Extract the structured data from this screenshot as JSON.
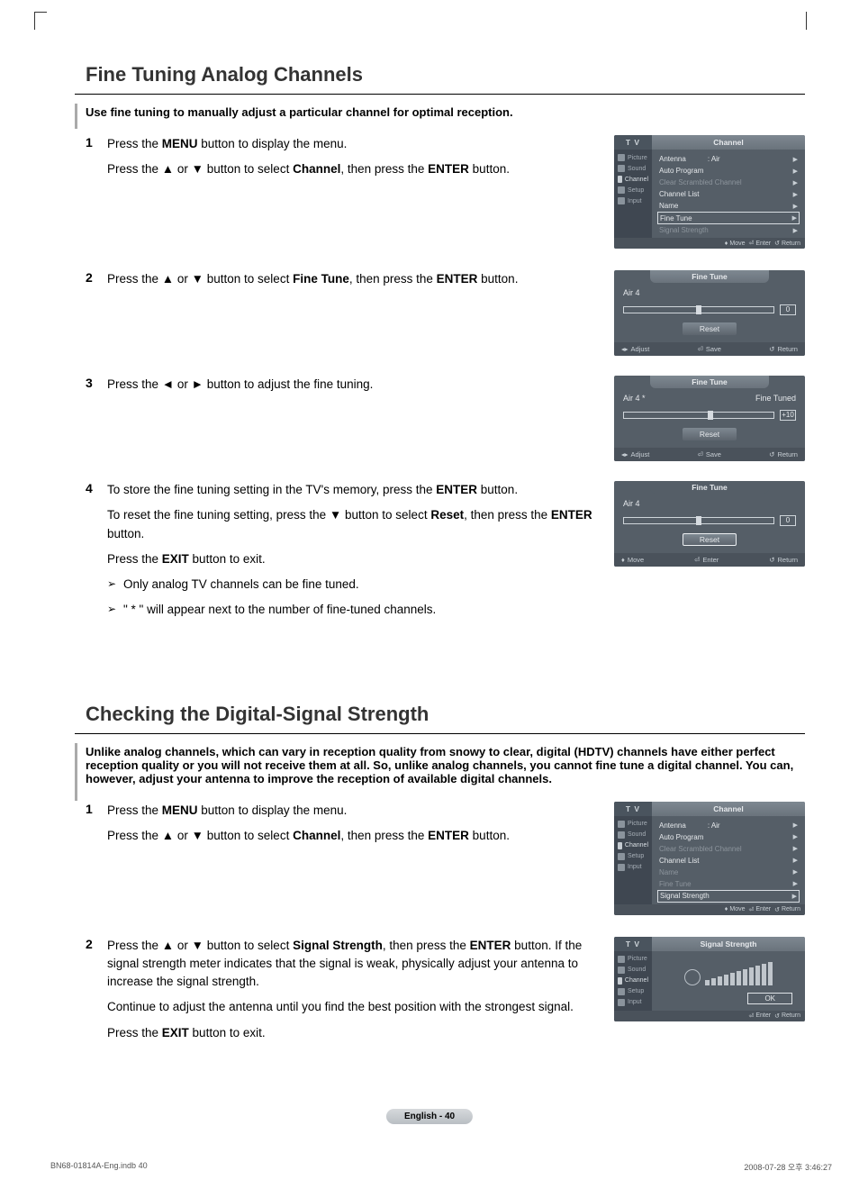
{
  "section1": {
    "title": "Fine Tuning Analog Channels",
    "intro": "Use fine tuning to manually adjust a particular channel for optimal reception.",
    "steps": [
      {
        "num": "1",
        "lines": [
          {
            "segments": [
              {
                "t": "Press the "
              },
              {
                "t": "MENU",
                "b": true
              },
              {
                "t": " button to display the menu."
              }
            ]
          },
          {
            "segments": [
              {
                "t": "Press the ▲ or ▼ button to select "
              },
              {
                "t": "Channel",
                "b": true
              },
              {
                "t": ", then press the "
              },
              {
                "t": "ENTER",
                "b": true
              },
              {
                "t": " button."
              }
            ]
          }
        ]
      },
      {
        "num": "2",
        "lines": [
          {
            "segments": [
              {
                "t": "Press the ▲ or ▼ button to select "
              },
              {
                "t": "Fine Tune",
                "b": true
              },
              {
                "t": ", then press the "
              },
              {
                "t": "ENTER",
                "b": true
              },
              {
                "t": " button."
              }
            ]
          }
        ]
      },
      {
        "num": "3",
        "lines": [
          {
            "segments": [
              {
                "t": "Press the ◄ or ► button to adjust the fine tuning."
              }
            ]
          }
        ]
      },
      {
        "num": "4",
        "lines": [
          {
            "segments": [
              {
                "t": "To store the fine tuning setting in the TV's memory, press the "
              },
              {
                "t": "ENTER",
                "b": true
              },
              {
                "t": " button."
              }
            ]
          },
          {
            "segments": [
              {
                "t": "To reset the fine tuning setting, press the ▼ button to select "
              },
              {
                "t": "Reset",
                "b": true
              },
              {
                "t": ", then press the "
              },
              {
                "t": "ENTER",
                "b": true
              },
              {
                "t": " button."
              }
            ]
          },
          {
            "segments": [
              {
                "t": "Press the "
              },
              {
                "t": "EXIT",
                "b": true
              },
              {
                "t": " button to exit."
              }
            ]
          }
        ],
        "notes": [
          "Only analog TV channels can be fine tuned.",
          "\" * \" will appear next to the number of fine-tuned channels."
        ]
      }
    ]
  },
  "section2": {
    "title": "Checking the Digital-Signal Strength",
    "intro": "Unlike analog channels, which can vary in reception quality from snowy to clear, digital (HDTV) channels have either perfect reception quality or you will not receive them at all. So, unlike analog channels, you cannot fine tune a digital channel. You can, however, adjust your antenna to improve the reception of available digital channels.",
    "steps": [
      {
        "num": "1",
        "lines": [
          {
            "segments": [
              {
                "t": "Press the "
              },
              {
                "t": "MENU",
                "b": true
              },
              {
                "t": " button to display the menu."
              }
            ]
          },
          {
            "segments": [
              {
                "t": "Press the ▲ or ▼ button to select "
              },
              {
                "t": "Channel",
                "b": true
              },
              {
                "t": ", then press the "
              },
              {
                "t": "ENTER",
                "b": true
              },
              {
                "t": " button."
              }
            ]
          }
        ]
      },
      {
        "num": "2",
        "lines": [
          {
            "segments": [
              {
                "t": "Press the ▲ or ▼ button to select "
              },
              {
                "t": "Signal Strength",
                "b": true
              },
              {
                "t": ", then press the "
              },
              {
                "t": "ENTER",
                "b": true
              },
              {
                "t": " button. If the signal strength meter indicates that the signal is weak, physically adjust your antenna to increase the signal strength."
              }
            ]
          },
          {
            "segments": [
              {
                "t": "Continue to adjust the antenna until you find the best position with the strongest signal."
              }
            ]
          },
          {
            "segments": [
              {
                "t": "Press the "
              },
              {
                "t": "EXIT",
                "b": true
              },
              {
                "t": " button to exit."
              }
            ]
          }
        ]
      }
    ]
  },
  "osd": {
    "tv": "T V",
    "channel_tab": "Channel",
    "side": [
      "Picture",
      "Sound",
      "Channel",
      "Setup",
      "Input"
    ],
    "menu_items": [
      {
        "label": "Antenna",
        "val": ": Air",
        "dim": false
      },
      {
        "label": "Auto Program",
        "dim": false
      },
      {
        "label": "Clear Scrambled Channel",
        "dim": true
      },
      {
        "label": "Channel List",
        "dim": false
      },
      {
        "label": "Name",
        "dim": false
      },
      {
        "label": "Fine Tune",
        "dim": false,
        "sel": true
      },
      {
        "label": "Signal Strength",
        "dim": true
      }
    ],
    "menu_items_sig": [
      {
        "label": "Antenna",
        "val": ": Air",
        "dim": false
      },
      {
        "label": "Auto Program",
        "dim": false
      },
      {
        "label": "Clear Scrambled Channel",
        "dim": true
      },
      {
        "label": "Channel List",
        "dim": false
      },
      {
        "label": "Name",
        "dim": true
      },
      {
        "label": "Fine Tune",
        "dim": true
      },
      {
        "label": "Signal Strength",
        "dim": false,
        "sel": true
      }
    ],
    "foot_move": "Move",
    "foot_enter": "Enter",
    "foot_return": "Return",
    "foot_adjust": "Adjust",
    "foot_save": "Save",
    "ft_title": "Fine Tune",
    "ft1": {
      "ch": "Air  4",
      "val": "0",
      "pos": "50%",
      "status": ""
    },
    "ft2": {
      "ch": "Air  4 *",
      "val": "+10",
      "pos": "58%",
      "status": "Fine Tuned"
    },
    "ft3": {
      "ch": "Air  4",
      "val": "0",
      "pos": "50%",
      "status": ""
    },
    "reset": "Reset",
    "sig_tab": "Signal Strength",
    "ok": "OK"
  },
  "page_label": "English - 40",
  "footer": {
    "left": "BN68-01814A-Eng.indb   40",
    "right": "2008-07-28   오후 3:46:27"
  }
}
